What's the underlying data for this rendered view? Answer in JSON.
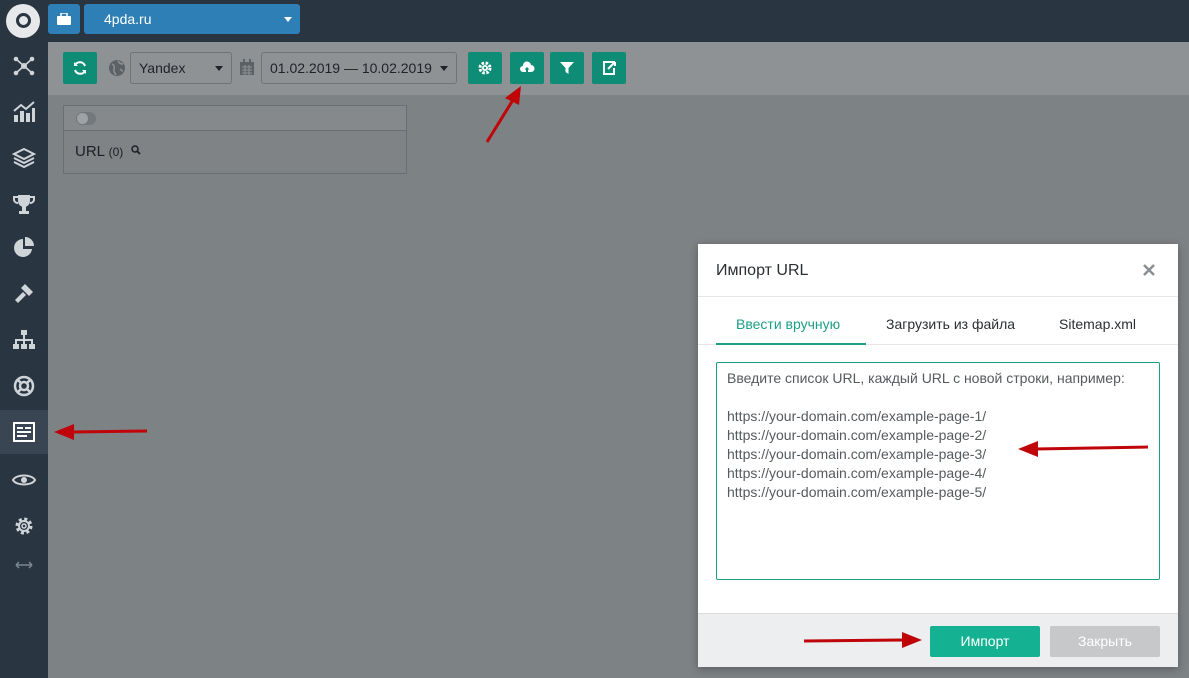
{
  "topbar": {
    "project_name": "4pda.ru"
  },
  "toolbar": {
    "search_engine": "Yandex",
    "date_range": "01.02.2019 — 10.02.2019",
    "buttons": [
      "refresh-icon",
      "settings-icon",
      "cloud-upload-icon",
      "filter-icon",
      "export-icon"
    ]
  },
  "sidebar": {
    "items": [
      "network-icon",
      "chart-icon",
      "layers-icon",
      "trophy-icon",
      "pie-icon",
      "hammer-icon",
      "sitemap-icon",
      "lifebuoy-icon",
      "list-icon",
      "eye-icon",
      "gear-icon",
      "expand-icon"
    ],
    "active_item": "list-icon"
  },
  "panel": {
    "url_label": "URL",
    "url_count": "(0)"
  },
  "modal": {
    "title": "Импорт URL",
    "tabs": [
      "Ввести вручную",
      "Загрузить из файла",
      "Sitemap.xml"
    ],
    "active_tab": "Ввести вручную",
    "placeholder": "Введите список URL, каждый URL с новой строки, например:\n\nhttps://your-domain.com/example-page-1/\nhttps://your-domain.com/example-page-2/\nhttps://your-domain.com/example-page-3/\nhttps://your-domain.com/example-page-4/\nhttps://your-domain.com/example-page-5/",
    "import_button": "Импорт",
    "close_button": "Закрыть"
  },
  "colors": {
    "accent": "#14b193",
    "sidebar": "#2a3542",
    "brand_blue": "#2d7fb5",
    "annotation_arrow": "#c0050a"
  }
}
